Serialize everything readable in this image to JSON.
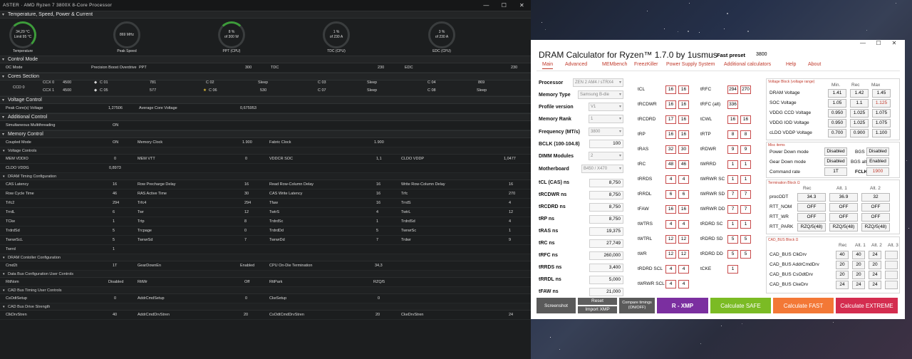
{
  "rm": {
    "title": "ASTER · AMD Ryzen 7 3800X 8-Core Processor",
    "sections": {
      "temp": "Temperature, Speed, Power & Current",
      "control": "Control Mode",
      "cores": "Cores Section",
      "voltage": "Voltage Control",
      "additional": "Additional Control",
      "memory": "Memory Control"
    },
    "gauges": [
      {
        "v1": "34,29 °C",
        "v2": "Limit 95 °C",
        "label": "Temperature"
      },
      {
        "v1": "869  MHz",
        "v2": "",
        "label": "Peak Speed"
      },
      {
        "v1": "8 %",
        "v2": "of 300 W",
        "label": "PPT (CPU)"
      },
      {
        "v1": "1 %",
        "v2": "of 230 A",
        "label": "TDC (CPU)"
      },
      {
        "v1": "3 %",
        "v2": "of 230 A",
        "label": "EDC (CPU)"
      }
    ],
    "ocmode": {
      "label": "OC Mode",
      "value": "Precision Boost Overdrive",
      "ppt": "PPT",
      "ppt_v": "300",
      "tdc": "TDC",
      "tdc_v": "230",
      "edc": "EDC",
      "edc_v": "230"
    },
    "cores": {
      "ccd": "CCD 0",
      "ccx0": "CCX 0",
      "ccx0_mhz": "4500",
      "ccx1": "CCX 1",
      "ccx1_mhz": "4500",
      "c01": "C 01",
      "c01v": "781",
      "c02": "C 02",
      "c02v": "Sleep",
      "c03": "C 03",
      "c03v": "Sleep",
      "c04": "C 04",
      "c04v": "869",
      "c05": "C 05",
      "c05v": "577",
      "c06": "C 06",
      "c06v": "530",
      "c07": "C 07",
      "c07v": "Sleep",
      "c08": "C 08",
      "c08v": "Sleep"
    },
    "volt": {
      "peak_l": "Peak Core(s) Voltage",
      "peak_v": "1,27506",
      "avg_l": "Average Core Voltage",
      "avg_v": "0,675953"
    },
    "addl": {
      "smt_l": "Simultaneous Multithreading",
      "smt_v": "ON"
    },
    "mem": {
      "coupled_l": "Coupled Mode",
      "coupled_v": "ON",
      "mclk_l": "Memory Clock",
      "mclk_v": "1.900",
      "fclk_l": "Fabric Clock",
      "fclk_v": "1.900"
    },
    "vc_title": "Voltage Controls",
    "vc": {
      "vddio_l": "MEM VDDIO",
      "vddio_v": "0",
      "vtt_l": "MEM VTT",
      "vtt_v": "0",
      "soc_l": "VDDCR SOC",
      "soc_v": "1,1",
      "vddp_l": "CLDO VDDP",
      "vddp_v": "1,0477",
      "vddg_l": "CLDO VDDG",
      "vddg_v": "0,8973"
    },
    "dt_title": "DRAM Timing Configuration",
    "timings": [
      [
        "CAS Latency",
        "16",
        "Row Precharge Delay",
        "16",
        "Read Row-Column Delay",
        "16",
        "Write Row-Column Delay",
        "16"
      ],
      [
        "Row Cycle Time",
        "46",
        "RAS Active Time",
        "30",
        "CAS Write Latency",
        "16",
        "Trfc",
        "270"
      ],
      [
        "Trfc2",
        "294",
        "Trfc4",
        "294",
        "Tfaw",
        "16",
        "TrrdS",
        "4"
      ],
      [
        "TrrdL",
        "6",
        "Twr",
        "12",
        "TwtrS",
        "4",
        "TwtrL",
        "12"
      ],
      [
        "TCke",
        "1",
        "Trtp",
        "8",
        "TrdrdSc",
        "1",
        "TrdrdSd",
        "4"
      ],
      [
        "TrdrdSd",
        "5",
        "Trcpage",
        "0",
        "TrdrdDd",
        "5",
        "TwrwrSc",
        "1"
      ],
      [
        "TwrwrScL",
        "5",
        "TwrwrSd",
        "7",
        "TwrwrDd",
        "7",
        "Trdwr",
        "9"
      ],
      [
        "Twrrd",
        "1",
        "",
        "",
        "",
        "",
        "",
        ""
      ]
    ],
    "ctrl_title": "DRAM Contoller Configuration",
    "ctrl": {
      "cmd_l": "Cmd2t",
      "cmd_v": "1T",
      "gd_l": "GearDownEn",
      "gd_v": "Enabled",
      "odt_l": "CPU On-Die Termination",
      "odt_v": "34,3"
    },
    "db_title": "Data Bus Configuration User Controls",
    "db": {
      "nom_l": "RttNom",
      "nom_v": "Disabled",
      "wr_l": "RttWr",
      "wr_v": "Off",
      "park_l": "RttPark",
      "park_v": "RZQ/5"
    },
    "cad_title": "CAD Bus Timing User Controls",
    "cad": {
      "a_l": "CsOdtSetup",
      "a_v": "0",
      "b_l": "AddrCmdSetup",
      "b_v": "0",
      "c_l": "CkeSetup",
      "c_v": "0"
    },
    "drv_title": "CAD Bus Drive Strength",
    "drv": {
      "a_l": "ClkDrvStren",
      "a_v": "40",
      "b_l": "AddrCmdDrvStren",
      "b_v": "20",
      "c_l": "CsOdtCmdDrvStren",
      "c_v": "20",
      "d_l": "CkeDrvStren",
      "d_v": "24"
    }
  },
  "dc": {
    "title": "DRAM Calculator for Ryzen™ 1.7.0 by 1usmus",
    "preset_l": "Fast preset",
    "preset_v": "3800",
    "tabs": [
      "Main",
      "Advanced",
      "MEMbench",
      "FreezKiller",
      "Power Supply System",
      "Additional calculators",
      "Help",
      "About"
    ],
    "left": {
      "proc_l": "Processor",
      "proc_v": "ZEN 2 AM4 / sTRX4",
      "memtype_l": "Memory Type",
      "memtype_v": "Samsung B-die",
      "prof_l": "Profile version",
      "prof_v": "V1",
      "rank_l": "Memory Rank",
      "rank_v": "1",
      "freq_l": "Frequency (MT/s)",
      "freq_v": "3800",
      "bclk_l": "BCLK (100-104.8)",
      "bclk_v": "100",
      "dimm_l": "DIMM Modules",
      "dimm_v": "2",
      "mb_l": "Motherboard",
      "mb_v": "B450 / X470",
      "ns": [
        [
          "tCL (CAS) ns",
          "8,750"
        ],
        [
          "tRCDWR ns",
          "8,750"
        ],
        [
          "tRCDRD ns",
          "8,750"
        ],
        [
          "tRP ns",
          "8,750"
        ],
        [
          "tRAS ns",
          "19,375"
        ],
        [
          "tRC ns",
          "27,749"
        ],
        [
          "tRFC ns",
          "260,000"
        ],
        [
          "tRRDS ns",
          "3,400"
        ],
        [
          "tRRDL ns",
          "5,000"
        ],
        [
          "tFAW ns",
          "21,000"
        ]
      ]
    },
    "t1": [
      [
        "tCL",
        "16",
        "16"
      ],
      [
        "tRCDWR",
        "16",
        "16"
      ],
      [
        "tRCDRD",
        "17",
        "16"
      ],
      [
        "tRP",
        "16",
        "16"
      ],
      [
        "tRAS",
        "32",
        "30"
      ],
      [
        "tRC",
        "48",
        "46"
      ],
      [
        "tRRDS",
        "4",
        "4"
      ],
      [
        "tRRDL",
        "6",
        "6"
      ],
      [
        "tFAW",
        "16",
        "16"
      ],
      [
        "tWTRS",
        "4",
        "4"
      ],
      [
        "tWTRL",
        "12",
        "12"
      ],
      [
        "tWR",
        "12",
        "12"
      ],
      [
        "tRDRD SCL",
        "4",
        "4"
      ],
      [
        "tWRWR SCL",
        "4",
        "4"
      ]
    ],
    "t2": [
      [
        "tRFC",
        "294",
        "270"
      ],
      [
        "tRFC (alt)",
        "336",
        ""
      ],
      [
        "tCWL",
        "16",
        "16"
      ],
      [
        "tRTP",
        "8",
        "8"
      ],
      [
        "tRDWR",
        "9",
        "9"
      ],
      [
        "tWRRD",
        "1",
        "1"
      ],
      [
        "tWRWR SC",
        "1",
        "1"
      ],
      [
        "tWRWR SD",
        "7",
        "7"
      ],
      [
        "tWRWR DD",
        "7",
        "7"
      ],
      [
        "tRDRD SC",
        "1",
        "1"
      ],
      [
        "tRDRD SD",
        "5",
        "5"
      ],
      [
        "tRDRD DD",
        "5",
        "5"
      ],
      [
        "tCKE",
        "1",
        ""
      ]
    ],
    "volt": {
      "title": "Voltage Block (voltage range)",
      "h": [
        "Min.",
        "Rec",
        "Max"
      ],
      "rows": [
        [
          "DRAM Voltage",
          "1.41",
          "1.42",
          "1.45"
        ],
        [
          "SOC Voltage",
          "1.05",
          "1.1",
          "1.125"
        ],
        [
          "VDDG  CCD Voltage",
          "0.950",
          "1.025",
          "1.075"
        ],
        [
          "VDDG  IOD Voltage",
          "0.950",
          "1.025",
          "1.075"
        ],
        [
          "cLDO VDDP Voltage",
          "0.700",
          "0.900",
          "1.100"
        ]
      ]
    },
    "misc": {
      "title": "Misc items",
      "pdm_l": "Power Down mode",
      "pdm_v": "Disabled",
      "bgs_l": "BGS",
      "bgs_v": "Disabled",
      "gdm_l": "Gear Down mode",
      "gdm_v": "Disabled",
      "bgsa_l": "BGS alt",
      "bgsa_v": "Enabled",
      "cr_l": "Command rate",
      "cr_v": "1T",
      "fclk_l": "FCLK",
      "fclk_v": "1900"
    },
    "term": {
      "title": "Termination Block Ω",
      "h": [
        "Rec",
        "Alt. 1",
        "Alt. 2"
      ],
      "rows": [
        [
          "procODT",
          "34.3",
          "36.9",
          "32"
        ],
        [
          "RTT_NOM",
          "OFF",
          "OFF",
          "OFF"
        ],
        [
          "RTT_WR",
          "OFF",
          "OFF",
          "OFF"
        ],
        [
          "RTT_PARK",
          "RZQ/5(48)",
          "RZQ/5(48)",
          "RZQ/5(48)"
        ]
      ]
    },
    "cad": {
      "title": "CAD_BUS Block Ω",
      "h": [
        "Rec",
        "Alt. 1",
        "Alt. 2",
        "Alt. 3"
      ],
      "rows": [
        [
          "CAD_BUS ClkDrv",
          "40",
          "40",
          "24",
          ""
        ],
        [
          "CAD_BUS AddrCmdDrv",
          "20",
          "20",
          "20",
          ""
        ],
        [
          "CAD_BUS CsOdtDrv",
          "20",
          "20",
          "24",
          ""
        ],
        [
          "CAD_BUS CkeDrv",
          "24",
          "24",
          "24",
          ""
        ]
      ]
    },
    "buttons": {
      "screenshot": "Screenshot",
      "reset": "Reset",
      "import": "Import XMP",
      "compare": "Compare timings (ON/OFF)",
      "rxmp": "R - XMP",
      "safe": "Calculate SAFE",
      "fast": "Calculate FAST",
      "extreme": "Calculate EXTREME"
    },
    "colors": {
      "accent": "#c0392b",
      "rxmp": "#7b2fa0",
      "safe": "#7bbb24",
      "fast": "#f37836",
      "extreme": "#d42d4f"
    }
  }
}
